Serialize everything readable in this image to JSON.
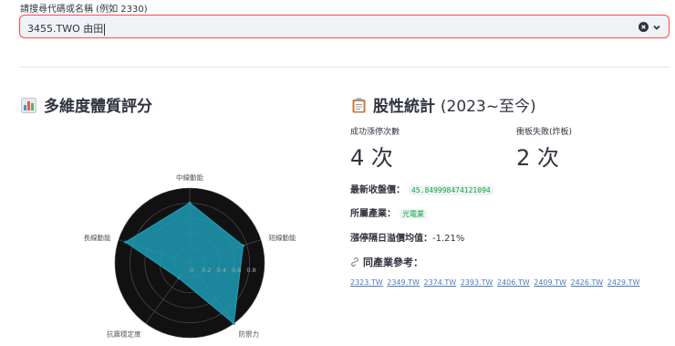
{
  "search": {
    "label": "請搜尋代碼或名稱 (例如 2330)",
    "value": "3455.TWO 由田"
  },
  "left_section": {
    "title": "多維度體質評分",
    "icon": "bar-chart-icon"
  },
  "right_section": {
    "title": "股性統計",
    "title_suffix": "(2023~至今)",
    "icon": "clipboard-icon"
  },
  "metrics": [
    {
      "label": "成功漲停次數",
      "value": "4 次"
    },
    {
      "label": "衝板失敗(炸板)",
      "value": "2 次"
    }
  ],
  "info": {
    "close_label": "最新收盤價：",
    "close_value": "45.849998474121094",
    "industry_label": "所屬產業：",
    "industry_value": "光電業",
    "premium_label": "漲停隔日溢價均值：",
    "premium_value": "-1.21%"
  },
  "peers": {
    "heading": "同產業參考：",
    "icon": "link-icon",
    "items": [
      "2323.TW",
      "2349.TW",
      "2374.TW",
      "2393.TW",
      "2406.TW",
      "2409.TW",
      "2426.TW",
      "2429.TW"
    ]
  },
  "chart_data": {
    "type": "radar",
    "axes": [
      "中線動能",
      "短線動能",
      "防禦力",
      "抗震穩定度",
      "長線動能"
    ],
    "values": [
      0.8,
      0.75,
      1.0,
      0.25,
      0.9
    ],
    "radial_ticks": [
      "0",
      "0.2",
      "0.4",
      "0.6",
      "0.8"
    ],
    "rmax": 1.0,
    "colors": {
      "fill": "#1f9bb5",
      "background": "#111111",
      "grid": "#555555"
    }
  }
}
